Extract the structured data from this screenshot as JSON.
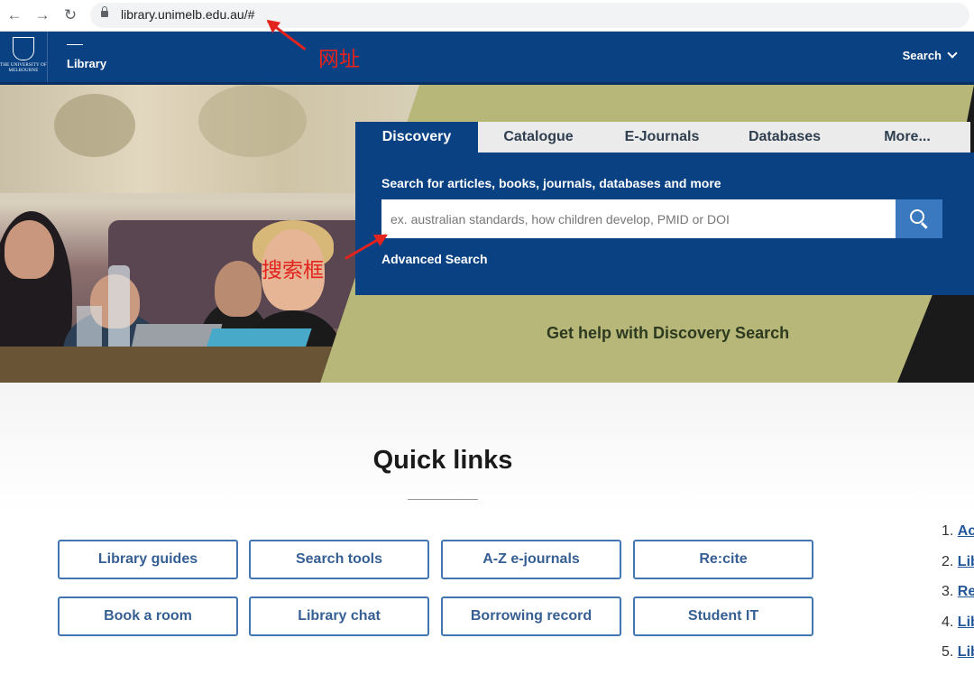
{
  "browser": {
    "url": "library.unimelb.edu.au/#",
    "icons": {
      "back": "back-arrow-icon",
      "forward": "forward-arrow-icon",
      "reload": "reload-icon",
      "lock": "lock-icon"
    }
  },
  "header": {
    "logo_text": "THE UNIVERSITY OF MELBOURNE",
    "site_title": "Library",
    "search_menu_label": "Search"
  },
  "search": {
    "tabs": [
      "Discovery",
      "Catalogue",
      "E-Journals",
      "Databases",
      "More..."
    ],
    "active_tab": "Discovery",
    "label": "Search for articles, books, journals, databases and more",
    "placeholder": "ex. australian standards, how children develop, PMID or DOI",
    "advanced_label": "Advanced Search",
    "help_text": "Get help with Discovery Search"
  },
  "annotations": {
    "url_note": "网址",
    "searchbox_note": "搜索框",
    "color": "#e3231d"
  },
  "quick_links": {
    "title": "Quick links",
    "buttons": [
      "Library guides",
      "Search tools",
      "A-Z e-journals",
      "Re:cite",
      "Book a room",
      "Library chat",
      "Borrowing record",
      "Student IT"
    ]
  },
  "side_list": [
    {
      "num": "1.",
      "text": "Ac"
    },
    {
      "num": "2.",
      "text": "Lib"
    },
    {
      "num": "3.",
      "text": "Re"
    },
    {
      "num": "4.",
      "text": "Lib"
    },
    {
      "num": "5.",
      "text": "Lib"
    }
  ],
  "colors": {
    "brand_navy": "#094183",
    "hero_olive": "#b7b779",
    "button_blue": "#3a79bf",
    "link_blue": "#365f93"
  }
}
